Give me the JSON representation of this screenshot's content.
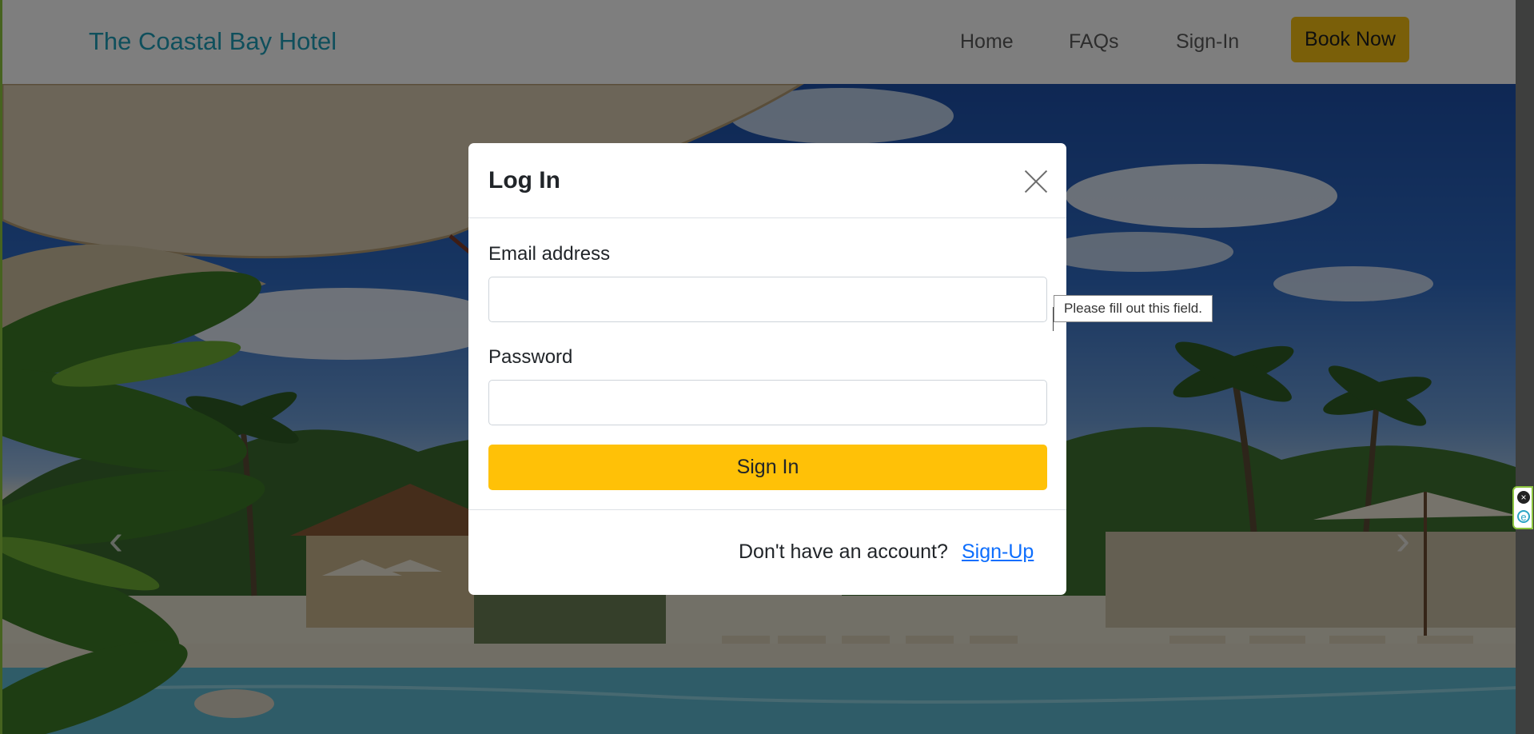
{
  "navbar": {
    "brand": "The Coastal Bay Hotel",
    "links": [
      {
        "label": "Home"
      },
      {
        "label": "FAQs"
      },
      {
        "label": "Sign-In"
      }
    ],
    "book_button": "Book Now"
  },
  "hero": {
    "prev_arrow": "‹",
    "next_arrow": "›"
  },
  "modal": {
    "title": "Log In",
    "email_label": "Email address",
    "email_value": "",
    "password_label": "Password",
    "password_value": "",
    "submit_label": "Sign In",
    "footer_text": "Don't have an account?",
    "signup_link": "Sign-Up"
  },
  "tooltip": {
    "message": "Please fill out this field."
  },
  "extension": {
    "close_glyph": "×",
    "e_glyph": "e"
  },
  "colors": {
    "brand": "#1f9fb8",
    "accent": "#ffc107",
    "link": "#0d6efd"
  }
}
